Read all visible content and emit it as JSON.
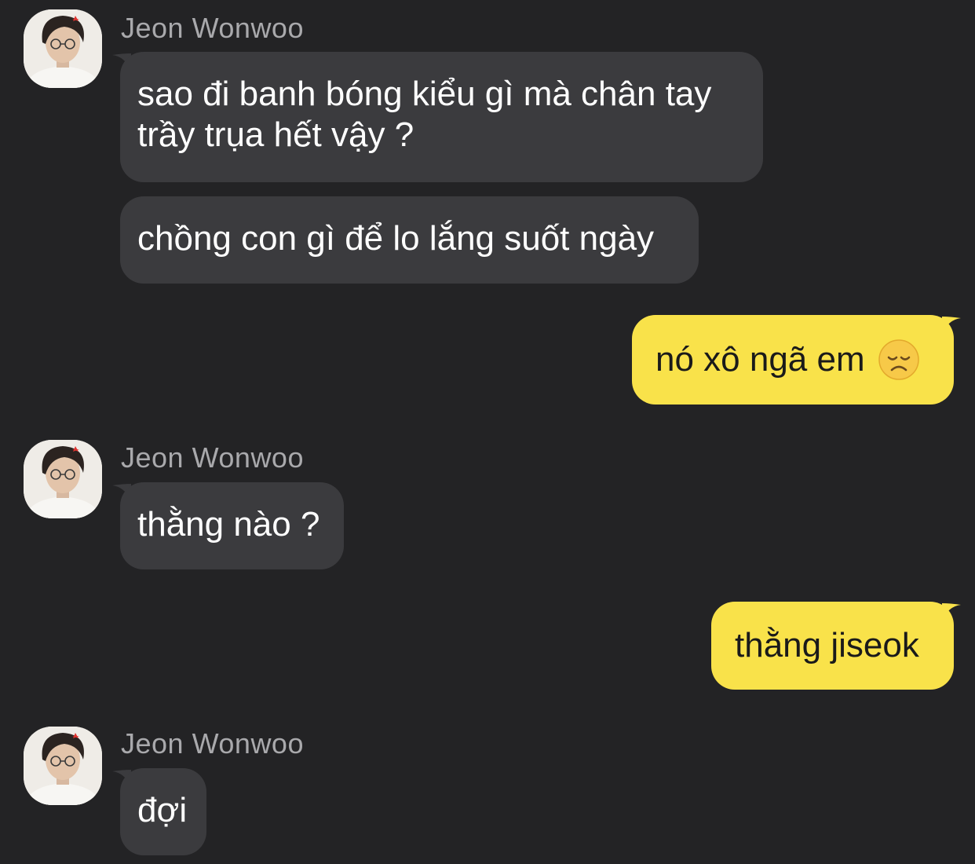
{
  "theme": {
    "background": "#232325",
    "incoming_bubble": "#3b3b3e",
    "outgoing_bubble": "#f9e24a",
    "sender_name_color": "#a9a9ac"
  },
  "messages": [
    {
      "direction": "incoming",
      "sender": "Jeon Wonwoo",
      "avatar_icon": "profile-photo-icon",
      "bubbles": [
        "sao đi banh bóng kiểu gì mà chân tay\ntrầy trụa hết vậy ?",
        "chồng con gì để lo lắng suốt ngày"
      ]
    },
    {
      "direction": "outgoing",
      "bubbles": [
        "nó xô ngã em"
      ],
      "emoji": "disappointed-face-icon"
    },
    {
      "direction": "incoming",
      "sender": "Jeon Wonwoo",
      "avatar_icon": "profile-photo-icon",
      "bubbles": [
        "thằng nào ?"
      ]
    },
    {
      "direction": "outgoing",
      "bubbles": [
        "thằng jiseok"
      ]
    },
    {
      "direction": "incoming",
      "sender": "Jeon Wonwoo",
      "avatar_icon": "profile-photo-icon",
      "bubbles": [
        "đợi"
      ]
    }
  ]
}
